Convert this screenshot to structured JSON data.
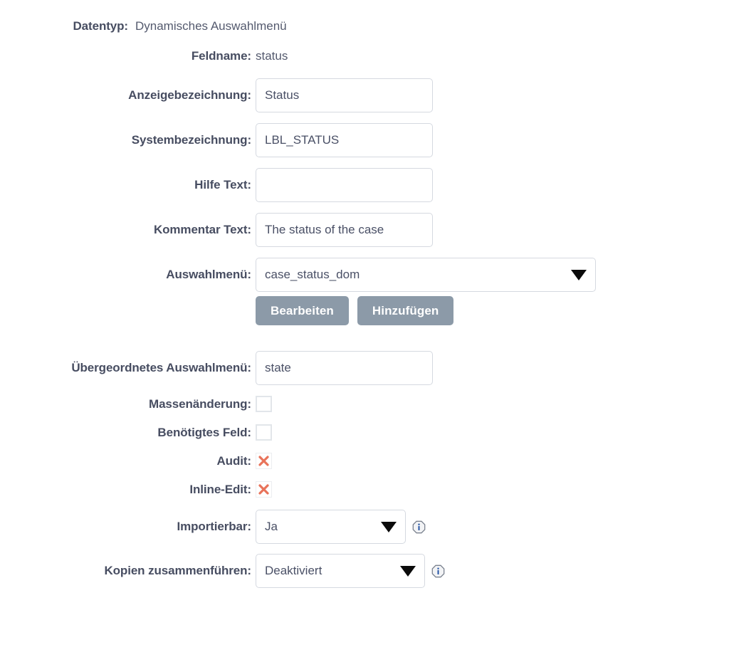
{
  "form": {
    "rows": {
      "datatype": {
        "label": "Datentyp:",
        "value": "Dynamisches Auswahlmenü"
      },
      "fieldname": {
        "label": "Feldname:",
        "value": "status"
      },
      "display_label": {
        "label": "Anzeigebezeichnung:",
        "value": "Status",
        "placeholder": ""
      },
      "system_label": {
        "label": "Systembezeichnung:",
        "value": "LBL_STATUS",
        "placeholder": ""
      },
      "help_text": {
        "label": "Hilfe Text:",
        "value": "",
        "placeholder": ""
      },
      "comment_text": {
        "label": "Kommentar Text:",
        "value": "The status of the case",
        "placeholder": ""
      },
      "dropdown": {
        "label": "Auswahlmenü:",
        "value": "case_status_dom",
        "caret_icon": "chevron-down-icon",
        "edit_button": "Bearbeiten",
        "add_button": "Hinzufügen"
      },
      "parent_dropdown": {
        "label": "Übergeordnetes Auswahlmenü:",
        "value": "state",
        "placeholder": ""
      },
      "mass_update": {
        "label": "Massenänderung:",
        "checked": false,
        "icon": "checkbox-unchecked-icon"
      },
      "required_field": {
        "label": "Benötigtes Feld:",
        "checked": false,
        "icon": "checkbox-unchecked-icon"
      },
      "audit": {
        "label": "Audit:",
        "value": "false",
        "icon": "red-x-icon"
      },
      "inline_edit": {
        "label": "Inline-Edit:",
        "value": "false",
        "icon": "red-x-icon"
      },
      "importable": {
        "label": "Importierbar:",
        "value": "Ja",
        "caret_icon": "chevron-down-icon",
        "info_icon": "info-icon"
      },
      "merge_duplicates": {
        "label": "Kopien zusammenführen:",
        "value": "Deaktiviert",
        "caret_icon": "chevron-down-icon",
        "info_icon": "info-icon"
      }
    }
  },
  "colors": {
    "label_text": "#474d61",
    "value_text": "#545a6e",
    "input_border": "#d5d9e0",
    "button_bg": "#8c9aa8",
    "button_text": "#ffffff",
    "x_mark": "#e8735a",
    "info_blue": "#1c4ea3",
    "page_bg": "#ffffff"
  }
}
